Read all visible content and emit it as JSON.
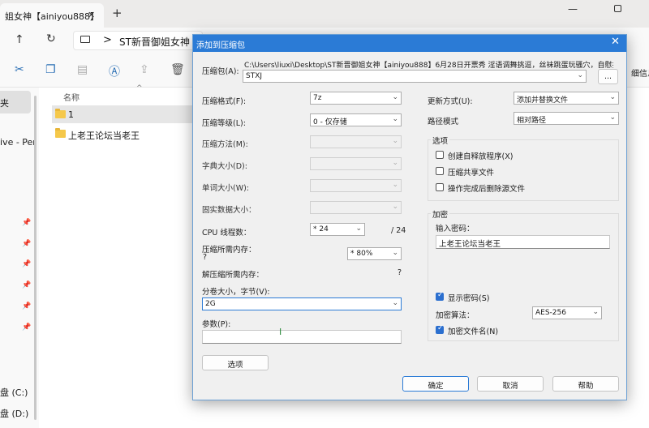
{
  "explorer": {
    "tab_title": "姐女神【ainiyou888】",
    "tab_close": "✕",
    "new_tab": "+",
    "min": "—",
    "nav_up": "↑",
    "nav_refresh": "↻",
    "address_chevron": ">",
    "address_path": "ST新晋御姐女神【",
    "details_label": "细信息",
    "column_name": "名称",
    "sort_indicator": "^",
    "sidebar": {
      "selected": "夹",
      "item_ive": "ive - Per",
      "drive_c": "盘 (C:)",
      "drive_d": "盘 (D:)"
    },
    "files": [
      {
        "name": "1"
      },
      {
        "name": "上老王论坛当老王"
      }
    ]
  },
  "dialog": {
    "title": "添加到压缩包",
    "close": "✕",
    "archive_label": "压缩包(A):",
    "archive_path": "C:\\Users\\liuxi\\Desktop\\ST新晋御姐女神【ainiyou888】6月28日开票秀 淫语调舞挑逗，丝袜跳蛋玩骚穴，自慰抽",
    "archive_name": "STXJ",
    "browse_label": "...",
    "format_label": "压缩格式(F):",
    "format_value": "7z",
    "level_label": "压缩等级(L):",
    "level_value": "0 - 仅存储",
    "method_label": "压缩方法(M):",
    "dict_label": "字典大小(D):",
    "word_label": "单词大小(W):",
    "solid_label": "固实数据大小：",
    "cpu_label": "CPU 线程数：",
    "cpu_value": "* 24",
    "cpu_total": "/ 24",
    "mem_label": "压缩所需内存：",
    "mem_q": "?",
    "mem_value": "* 80%",
    "decomp_label": "解压缩所需内存：",
    "decomp_q": "?",
    "split_label": "分卷大小，字节(V):",
    "split_value": "2G",
    "params_label": "参数(P):",
    "params_value": "",
    "options_button": "选项",
    "update_label": "更新方式(U):",
    "update_value": "添加并替换文件",
    "pathmode_label": "路径模式",
    "pathmode_value": "相对路径",
    "options_group": "选项",
    "opt_sfx": "创建自释放程序(X)",
    "opt_shared": "压缩共享文件",
    "opt_delete": "操作完成后删除源文件",
    "encrypt_group": "加密",
    "password_label": "输入密码：",
    "password_value": "上老王论坛当老王",
    "show_password": "显示密码(S)",
    "enc_method_label": "加密算法：",
    "enc_method_value": "AES-256",
    "encrypt_names": "加密文件名(N)",
    "ok": "确定",
    "cancel": "取消",
    "help": "帮助"
  },
  "colors": {
    "accent": "#2b7bd6",
    "folder": "#f5c84a"
  }
}
